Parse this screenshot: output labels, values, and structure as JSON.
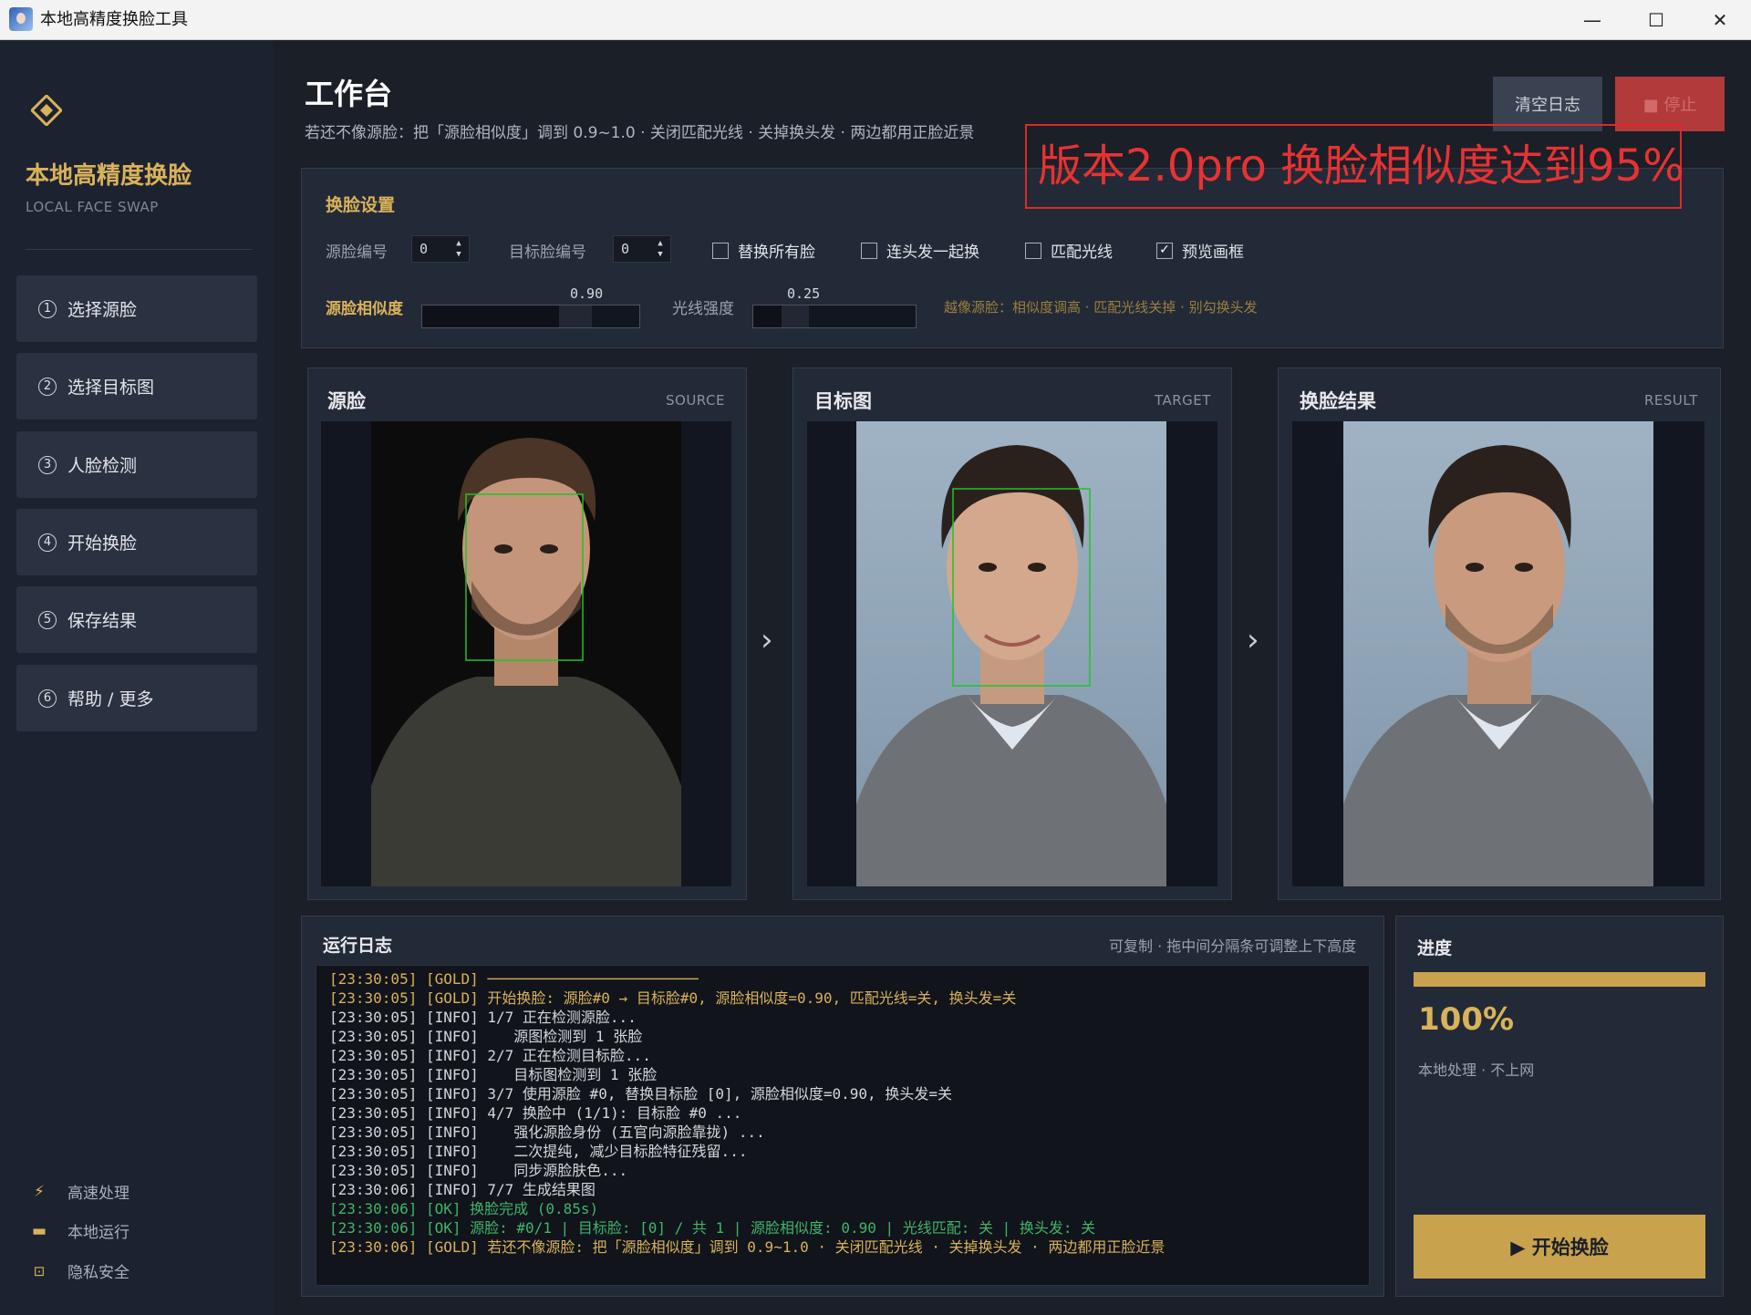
{
  "window": {
    "title": "本地高精度换脸工具",
    "minimize": "—",
    "maximize": "☐",
    "close": "✕"
  },
  "brand": {
    "title": "本地高精度换脸",
    "subtitle": "LOCAL FACE SWAP"
  },
  "nav": [
    {
      "num": "1",
      "label": "选择源脸"
    },
    {
      "num": "2",
      "label": "选择目标图"
    },
    {
      "num": "3",
      "label": "人脸检测"
    },
    {
      "num": "4",
      "label": "开始换脸"
    },
    {
      "num": "5",
      "label": "保存结果"
    },
    {
      "num": "6",
      "label": "帮助 / 更多"
    }
  ],
  "footer": [
    {
      "icon": "lightning-icon",
      "glyph": "⚡",
      "label": "高速处理"
    },
    {
      "icon": "computer-icon",
      "glyph": "▬",
      "label": "本地运行"
    },
    {
      "icon": "lock-icon",
      "glyph": "🔒",
      "label": "隐私安全"
    }
  ],
  "header": {
    "title": "工作台",
    "tip": "若还不像源脸：把「源脸相似度」调到 0.9~1.0 · 关闭匹配光线 · 关掉换头发 · 两边都用正脸近景",
    "clear_log": "清空日志",
    "stop": "■ 停止",
    "banner": "版本2.0pro 换脸相似度达到95%"
  },
  "settings": {
    "title": "换脸设置",
    "source_index_label": "源脸编号",
    "source_index_value": "0",
    "target_index_label": "目标脸编号",
    "target_index_value": "0",
    "checkboxes": [
      {
        "label": "替换所有脸",
        "checked": false
      },
      {
        "label": "连头发一起换",
        "checked": false
      },
      {
        "label": "匹配光线",
        "checked": false
      },
      {
        "label": "预览画框",
        "checked": true
      }
    ],
    "similarity_label": "源脸相似度",
    "similarity_value": "0.90",
    "similarity_level": 0.9,
    "light_label": "光线强度",
    "light_value": "0.25",
    "light_level": 0.25,
    "hint": "越像源脸：相似度调高 · 匹配光线关掉 · 别勾换头发"
  },
  "panels": [
    {
      "title": "源脸",
      "sub": "SOURCE"
    },
    {
      "title": "目标图",
      "sub": "TARGET"
    },
    {
      "title": "换脸结果",
      "sub": "RESULT"
    }
  ],
  "log": {
    "title": "运行日志",
    "hint": "可复制 · 拖中间分隔条可调整上下高度",
    "lines": [
      {
        "t": "[23:30:05] [GOLD] ────────────────────────",
        "c": "gold"
      },
      {
        "t": "[23:30:05] [GOLD] 开始换脸: 源脸#0 → 目标脸#0, 源脸相似度=0.90, 匹配光线=关, 换头发=关",
        "c": "gold"
      },
      {
        "t": "[23:30:05] [INFO] 1/7 正在检测源脸...",
        "c": "info"
      },
      {
        "t": "[23:30:05] [INFO]    源图检测到 1 张脸",
        "c": "info"
      },
      {
        "t": "[23:30:05] [INFO] 2/7 正在检测目标脸...",
        "c": "info"
      },
      {
        "t": "[23:30:05] [INFO]    目标图检测到 1 张脸",
        "c": "info"
      },
      {
        "t": "[23:30:05] [INFO] 3/7 使用源脸 #0, 替换目标脸 [0], 源脸相似度=0.90, 换头发=关",
        "c": "info"
      },
      {
        "t": "[23:30:05] [INFO] 4/7 换脸中 (1/1): 目标脸 #0 ...",
        "c": "info"
      },
      {
        "t": "[23:30:05] [INFO]    强化源脸身份 (五官向源脸靠拢) ...",
        "c": "info"
      },
      {
        "t": "[23:30:05] [INFO]    二次提纯, 减少目标脸特征残留...",
        "c": "info"
      },
      {
        "t": "[23:30:05] [INFO]    同步源脸肤色...",
        "c": "info"
      },
      {
        "t": "[23:30:06] [INFO] 7/7 生成结果图",
        "c": "info"
      },
      {
        "t": "[23:30:06] [OK] 换脸完成 (0.85s)",
        "c": "ok"
      },
      {
        "t": "[23:30:06] [OK] 源脸: #0/1 | 目标脸: [0] / 共 1 | 源脸相似度: 0.90 | 光线匹配: 关 | 换头发: 关",
        "c": "ok"
      },
      {
        "t": "[23:30:06] [GOLD] 若还不像源脸: 把「源脸相似度」调到 0.9~1.0 · 关闭匹配光线 · 关掉换头发 · 两边都用正脸近景",
        "c": "gold"
      }
    ]
  },
  "progress": {
    "title": "进度",
    "percent_text": "100%",
    "level": 1.0,
    "note": "本地处理 · 不上网",
    "start": "▶  开始换脸"
  }
}
